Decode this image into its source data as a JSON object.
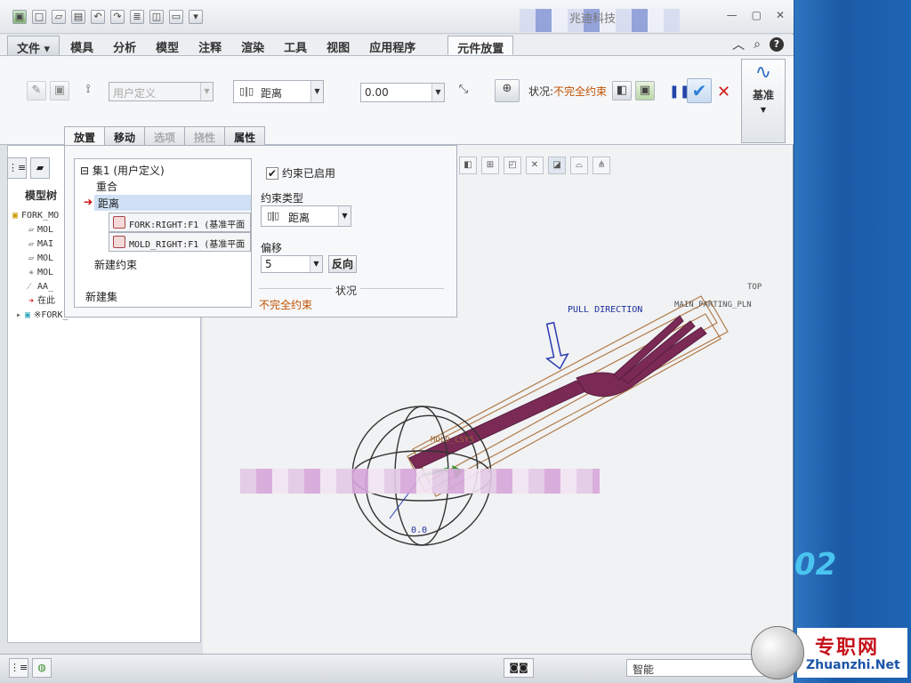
{
  "window": {
    "title": "兆迪科技"
  },
  "quick_access": [
    "new-icon",
    "open-icon",
    "save-icon",
    "undo-icon",
    "redo-icon",
    "regenerate-icon",
    "windows-icon",
    "close-window-icon",
    "more-icon"
  ],
  "ribbon_tabs": [
    {
      "label": "文件",
      "kind": "file"
    },
    {
      "label": "模具"
    },
    {
      "label": "分析"
    },
    {
      "label": "模型"
    },
    {
      "label": "注释"
    },
    {
      "label": "渲染"
    },
    {
      "label": "工具"
    },
    {
      "label": "视图"
    },
    {
      "label": "应用程序"
    },
    {
      "label": "元件放置",
      "active": true
    }
  ],
  "dashboard": {
    "user_defined": "用户定义",
    "constraint_type": "距离",
    "offset_value": "0.00",
    "status_label": "状况:",
    "status_value": "不完全约束",
    "datum_label": "基准"
  },
  "sub_tabs": [
    {
      "label": "放置",
      "state": "active"
    },
    {
      "label": "移动"
    },
    {
      "label": "选项",
      "state": "disabled"
    },
    {
      "label": "挠性",
      "state": "disabled"
    },
    {
      "label": "属性"
    }
  ],
  "placement": {
    "set_label": "集1 (用户定义)",
    "coincident": "重合",
    "distance": "距离",
    "ref1": "FORK:RIGHT:F1 (基准平面",
    "ref2": "MOLD_RIGHT:F1 (基准平面",
    "new_constraint": "新建约束",
    "new_set": "新建集",
    "enabled_label": "约束已启用",
    "constraint_type_label": "约束类型",
    "constraint_type_value": "距离",
    "offset_label": "偏移",
    "offset_value": "5",
    "flip_label": "反向",
    "status_title": "状况",
    "status_value": "不完全约束"
  },
  "model_tree": {
    "title": "模型树",
    "items": [
      {
        "icon": "assembly-icon",
        "text": "FORK_MO"
      },
      {
        "icon": "plane-icon",
        "text": "MOL"
      },
      {
        "icon": "plane-icon",
        "text": "MAI"
      },
      {
        "icon": "plane-icon",
        "text": "MOL"
      },
      {
        "icon": "csys-icon",
        "text": "MOL"
      },
      {
        "icon": "axis-icon",
        "text": "AA_"
      },
      {
        "icon": "insert-here-icon",
        "text": "在此"
      },
      {
        "icon": "part-icon",
        "text": "※FORK_"
      }
    ]
  },
  "viewport_labels": {
    "pull_direction": "PULL DIRECTION",
    "top": "TOP",
    "main_parting": "MAIN_PARTING_PLN",
    "mold_csys": "MOLD_CSYS",
    "dim": "0.0"
  },
  "statusbar": {
    "smart": "智能"
  },
  "brand": {
    "num": "02",
    "zh": "专职网",
    "en": "Zhuanzhi.Net"
  },
  "colors": {
    "accent": "#2e7fd6",
    "status_warn": "#c05000",
    "fork": "#7a2a55",
    "datum": "#b07b4a",
    "cancel": "#d01b1b"
  }
}
